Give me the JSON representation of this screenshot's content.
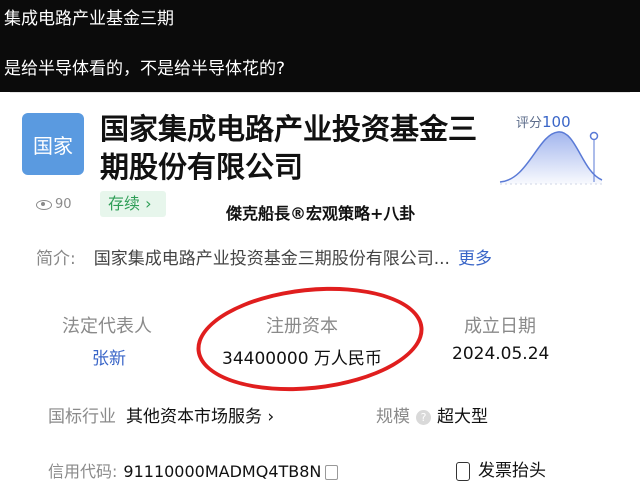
{
  "post": {
    "line1": "集成电路产业基金三期",
    "line2": "是给半导体看的，不是给半导体花的?"
  },
  "company": {
    "logo_text": "国家",
    "name": "国家集成电路产业投资基金三期股份有限公司",
    "score_label": "评分",
    "score_value": "100",
    "views": "90",
    "status": "存续 ›",
    "watermark": "傑克船長®宏观策略+八卦",
    "intro_label": "简介:",
    "intro_text": "国家集成电路产业投资基金三期股份有限公司...",
    "more_label": "更多",
    "legal_rep_label": "法定代表人",
    "legal_rep_value": "张新",
    "capital_label": "注册资本",
    "capital_value": "34400000 万人民币",
    "founded_label": "成立日期",
    "founded_value": "2024.05.24",
    "industry_label": "国标行业",
    "industry_value": "其他资本市场服务 ›",
    "scale_label": "规模",
    "scale_value": "超大型",
    "credit_label": "信用代码:",
    "credit_value": "91110000MADMQ4TB8N",
    "invoice_label": "发票抬头"
  },
  "colors": {
    "accent": "#3a66c8",
    "status_green": "#2f9e57",
    "highlight_red": "#e01e1e",
    "logo_blue": "#5a9ae0"
  }
}
